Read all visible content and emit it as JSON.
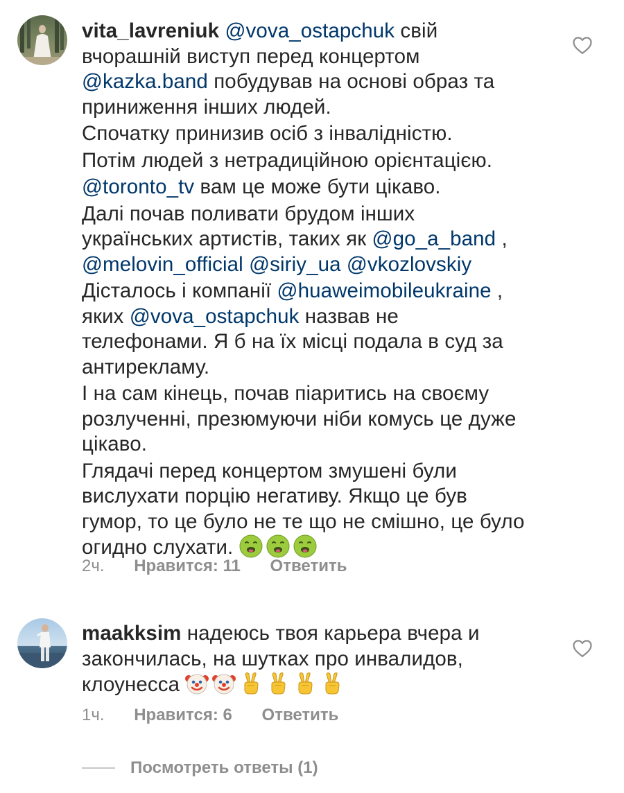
{
  "comments": [
    {
      "username": "vita_lavreniuk",
      "paragraphs": [
        [
          {
            "text": "vita_lavreniuk",
            "kind": "username"
          },
          {
            "text": " ",
            "kind": "text"
          },
          {
            "text": "@vova_ostapchuk",
            "kind": "mention"
          },
          {
            "text": " свій вчорашній виступ перед концертом ",
            "kind": "text"
          },
          {
            "text": "@kazka.band",
            "kind": "mention"
          },
          {
            "text": " побудував на основі образ та приниження інших людей.",
            "kind": "text"
          }
        ],
        [
          {
            "text": "Спочатку принизив осіб з інвалідністю.",
            "kind": "text"
          }
        ],
        [
          {
            "text": "Потім людей з нетрадиційною орієнтацією.",
            "kind": "text"
          }
        ],
        [
          {
            "text": "@toronto_tv",
            "kind": "mention"
          },
          {
            "text": " вам це може бути цікаво.",
            "kind": "text"
          }
        ],
        [
          {
            "text": "Далі почав поливати брудом інших українських артистів, таких як ",
            "kind": "text"
          },
          {
            "text": "@go_a_band",
            "kind": "mention"
          },
          {
            "text": " , ",
            "kind": "text"
          },
          {
            "text": "@melovin_official",
            "kind": "mention"
          },
          {
            "text": " ",
            "kind": "text"
          },
          {
            "text": "@siriy_ua",
            "kind": "mention"
          },
          {
            "text": " ",
            "kind": "text"
          },
          {
            "text": "@vkozlovskiy",
            "kind": "mention"
          }
        ],
        [
          {
            "text": "Дісталось і компанії ",
            "kind": "text"
          },
          {
            "text": "@huaweimobileukraine",
            "kind": "mention"
          },
          {
            "text": " , яких ",
            "kind": "text"
          },
          {
            "text": "@vova_ostapchuk",
            "kind": "mention"
          },
          {
            "text": " назвав не телефонами. Я б на їх місці подала в суд за антирекламу.",
            "kind": "text"
          }
        ],
        [
          {
            "text": "І на сам кінець, почав піаритись на своєму розлученні, презюмуючи ніби комусь це дуже цікаво.",
            "kind": "text"
          }
        ],
        [
          {
            "text": "Глядачі перед концертом змушені були вислухати порцію негативу. Якщо це був гумор, то це було не те що не смішно, це було огидно слухати. ",
            "kind": "text"
          },
          {
            "text": "nauseated-face",
            "kind": "emoji"
          },
          {
            "text": "nauseated-face",
            "kind": "emoji"
          },
          {
            "text": "nauseated-face",
            "kind": "emoji"
          }
        ]
      ],
      "time": "2ч.",
      "likes": "Нравится: 11",
      "reply": "Ответить"
    },
    {
      "username": "maakksim",
      "paragraphs": [
        [
          {
            "text": "maakksim",
            "kind": "username"
          },
          {
            "text": " надеюсь твоя карьера вчера и закончилась, на шутках про инвалидов, клоунесса ",
            "kind": "text"
          },
          {
            "text": "clown-face",
            "kind": "emoji"
          },
          {
            "text": "clown-face",
            "kind": "emoji"
          },
          {
            "text": "victory-hand",
            "kind": "emoji"
          },
          {
            "text": "victory-hand",
            "kind": "emoji"
          },
          {
            "text": "victory-hand",
            "kind": "emoji"
          },
          {
            "text": "victory-hand",
            "kind": "emoji"
          }
        ]
      ],
      "time": "1ч.",
      "likes": "Нравится: 6",
      "reply": "Ответить"
    }
  ],
  "view_replies": "Посмотреть ответы (1)",
  "icons": {
    "like": "heart-outline-icon"
  },
  "colors": {
    "text": "#262626",
    "mention": "#00376b",
    "meta": "#8e8e8e"
  }
}
